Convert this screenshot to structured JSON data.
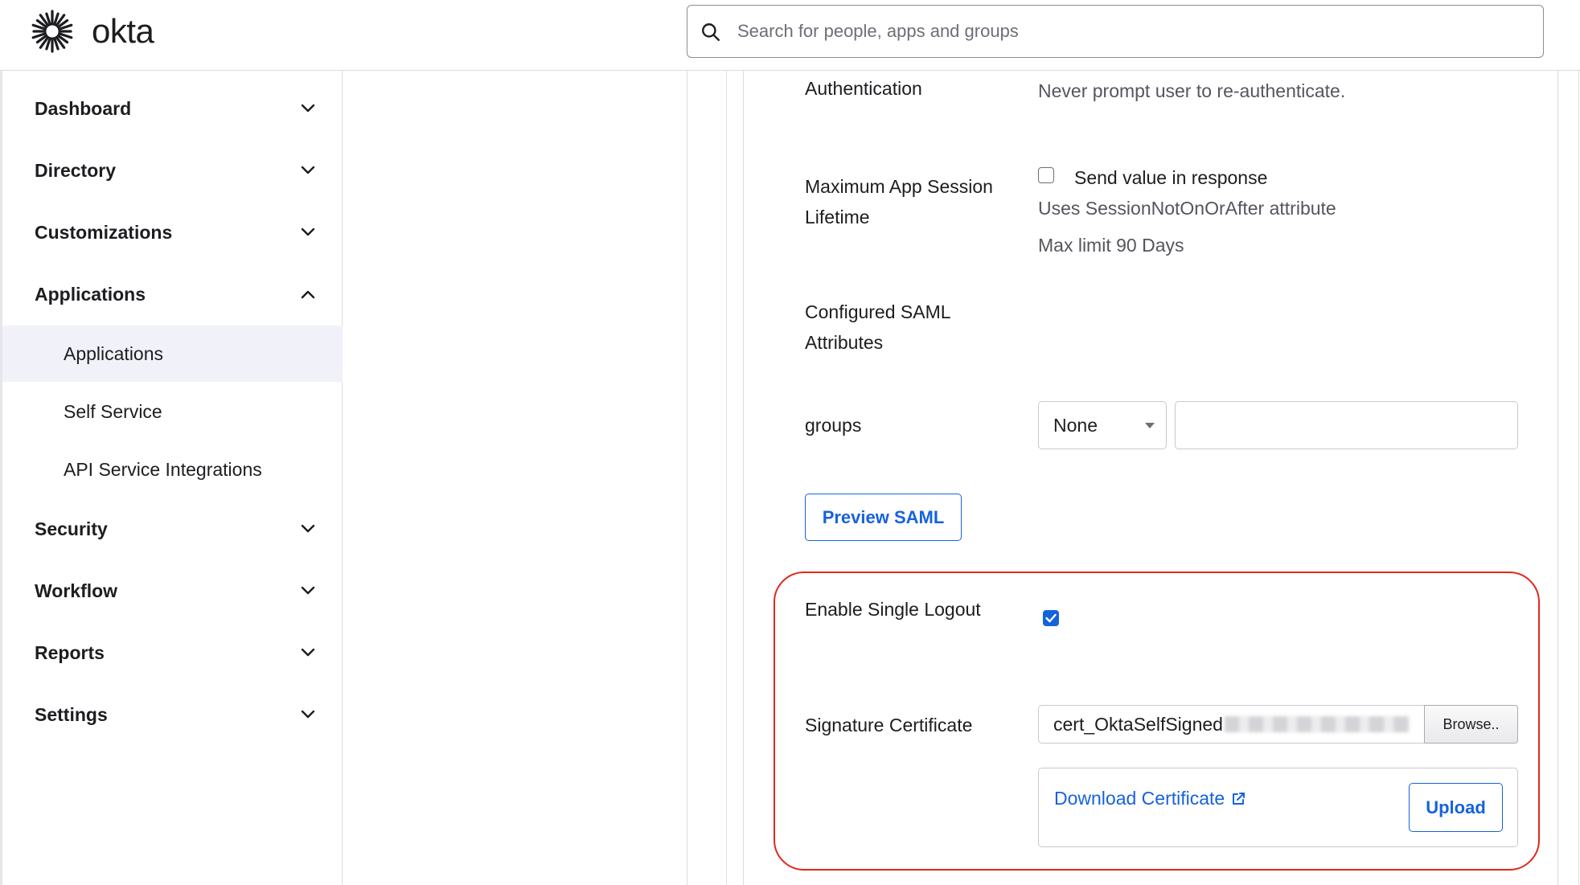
{
  "header": {
    "logo_text": "okta",
    "search_placeholder": "Search for people, apps and groups"
  },
  "sidebar": {
    "items": [
      {
        "label": "Dashboard",
        "expanded": false
      },
      {
        "label": "Directory",
        "expanded": false
      },
      {
        "label": "Customizations",
        "expanded": false
      },
      {
        "label": "Applications",
        "expanded": true
      },
      {
        "label": "Security",
        "expanded": false
      },
      {
        "label": "Workflow",
        "expanded": false
      },
      {
        "label": "Reports",
        "expanded": false
      },
      {
        "label": "Settings",
        "expanded": false
      }
    ],
    "sub_items": [
      {
        "label": "Applications",
        "active": true
      },
      {
        "label": "Self Service",
        "active": false
      },
      {
        "label": "API Service Integrations",
        "active": false
      }
    ]
  },
  "content": {
    "authentication": {
      "label": "Authentication",
      "value": "Never prompt user to re-authenticate."
    },
    "max_session": {
      "label_line1": "Maximum App Session",
      "label_line2": "Lifetime",
      "checkbox_label": "Send value in response",
      "checked": false,
      "hint": "Uses SessionNotOnOrAfter attribute",
      "limit": "Max limit 90 Days"
    },
    "saml_attributes": {
      "label_line1": "Configured SAML",
      "label_line2": "Attributes"
    },
    "groups": {
      "label": "groups",
      "select_value": "None",
      "input_value": ""
    },
    "preview_button": "Preview SAML",
    "single_logout": {
      "label": "Enable Single Logout",
      "checked": true
    },
    "signature_certificate": {
      "label": "Signature Certificate",
      "file_name": "cert_OktaSelfSigned",
      "browse_label": "Browse..",
      "download_link": "Download Certificate",
      "upload_label": "Upload"
    }
  },
  "colors": {
    "accent": "#1662dd",
    "highlight": "#e0291c",
    "active_nav_bg": "#f1f2f9"
  }
}
